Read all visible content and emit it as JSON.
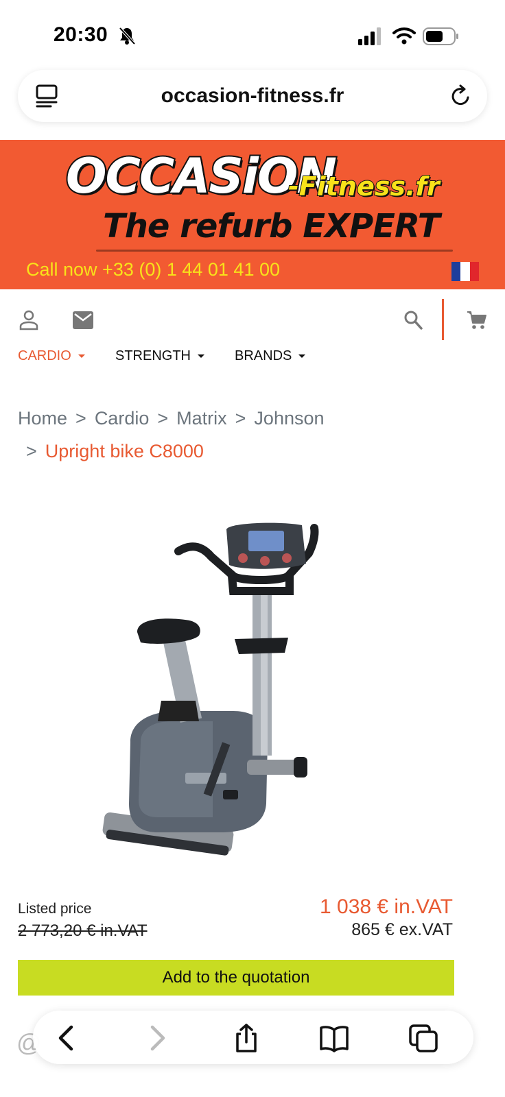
{
  "status_bar": {
    "time": "20:30",
    "icons": [
      "bell-slash-icon",
      "cellular-signal-icon",
      "wifi-icon",
      "battery-icon"
    ]
  },
  "browser": {
    "url": "occasion-fitness.fr",
    "icons": [
      "reader-mode-icon",
      "reload-icon"
    ]
  },
  "header": {
    "logo_main": "OCCASiON",
    "logo_sub": "-Fitness.fr",
    "tagline": "The refurb EXPERT",
    "call_now": "Call now +33 (0) 1 44 01 41 00",
    "flag": "french-flag",
    "colors": {
      "banner": "#f25a32",
      "accent_yellow": "#f8e21a",
      "accent_orange": "#e85a32"
    }
  },
  "nav": {
    "icons": [
      "user-icon",
      "mail-icon",
      "search-icon",
      "cart-icon"
    ],
    "menu": [
      {
        "label": "CARDIO",
        "active": true
      },
      {
        "label": "STRENGTH",
        "active": false
      },
      {
        "label": "BRANDS",
        "active": false
      }
    ]
  },
  "breadcrumb": {
    "items": [
      "Home",
      "Cardio",
      "Matrix",
      "Johnson"
    ],
    "current": "Upright bike C8000",
    "separator": ">"
  },
  "product": {
    "image_alt": "upright exercise bike",
    "listed_label": "Listed price",
    "listed_price": "2 773,20 € in.VAT",
    "price_vat": "1 038 € in.VAT",
    "price_exvat": "865 € ex.VAT",
    "cta": "Add to the quotation",
    "cta_color": "#c8dc22"
  },
  "toolbar": {
    "icons": [
      "back-icon",
      "forward-icon",
      "share-icon",
      "bookmarks-icon",
      "tabs-icon"
    ]
  }
}
